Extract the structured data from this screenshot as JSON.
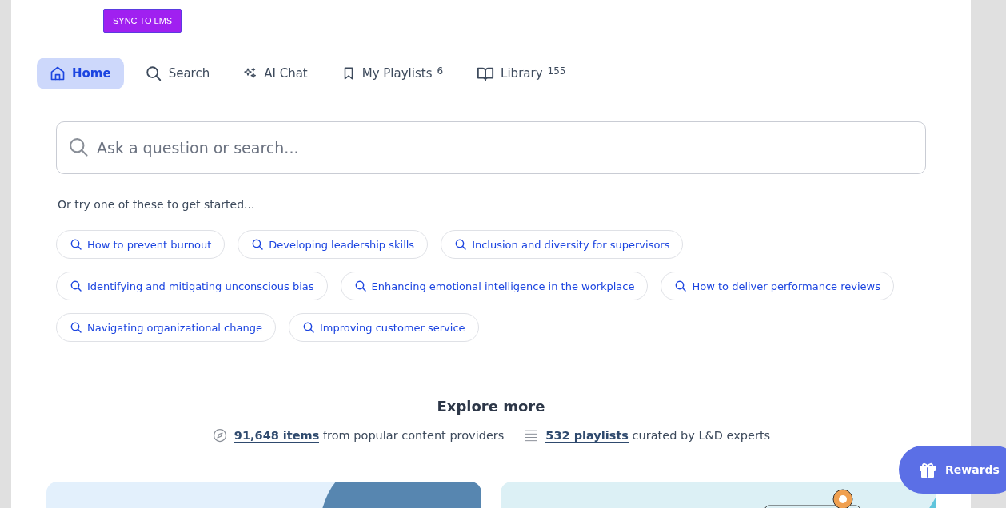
{
  "sync_button": "SYNC TO LMS",
  "tabs": [
    {
      "kind": "home",
      "label": "Home",
      "selected": true
    },
    {
      "kind": "search",
      "label": "Search",
      "selected": false
    },
    {
      "kind": "ai",
      "label": "AI Chat",
      "selected": false
    },
    {
      "kind": "playlists",
      "label": "My Playlists",
      "count": "6",
      "selected": false
    },
    {
      "kind": "library",
      "label": "Library",
      "count": "155",
      "selected": false
    }
  ],
  "search": {
    "placeholder": "Ask a question or search..."
  },
  "suggestions_intro": "Or try one of these to get started...",
  "suggestions": [
    [
      "How to prevent burnout",
      "Developing leadership skills",
      "Inclusion and diversity for supervisors"
    ],
    [
      "Identifying and mitigating unconscious bias",
      "Enhancing emotional intelligence in the workplace",
      "How to deliver performance reviews"
    ],
    [
      "Navigating organizational change",
      "Improving customer service"
    ]
  ],
  "explore": {
    "title": "Explore more",
    "stats": [
      {
        "kind": "items",
        "link": "91,648 items",
        "text": "from popular content providers"
      },
      {
        "kind": "playlists",
        "link": "532 playlists",
        "text": "curated by L&D experts"
      }
    ]
  },
  "rewards_button": "Rewards"
}
